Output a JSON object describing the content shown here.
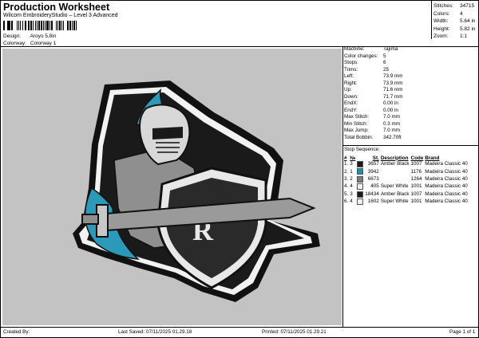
{
  "header": {
    "title": "Production Worksheet",
    "subtitle": "Wilcom EmbroideryStudio – Level 3 Advanced",
    "design_label": "Design:",
    "design_value": "Aroyo 5,8in",
    "colorway_label": "Colorway:",
    "colorway_value": "Colorway 1"
  },
  "stats": [
    {
      "label": "Stitches:",
      "value": "34715"
    },
    {
      "label": "Colors:",
      "value": "4"
    },
    {
      "label": "Width:",
      "value": "5.64 in"
    },
    {
      "label": "Height:",
      "value": "5.82 in"
    },
    {
      "label": "Zoom:",
      "value": "1:1"
    }
  ],
  "info": [
    {
      "label": "Machine:",
      "value": "Tajima"
    },
    {
      "label": "Color changes:",
      "value": "5"
    },
    {
      "label": "Stops:",
      "value": "6"
    },
    {
      "label": "Trims:",
      "value": "25"
    },
    {
      "label": "Left:",
      "value": "73.9 mm"
    },
    {
      "label": "Right:",
      "value": "73.9 mm"
    },
    {
      "label": "Up:",
      "value": "71.6 mm"
    },
    {
      "label": "Down:",
      "value": "71.7 mm"
    },
    {
      "label": "EndX:",
      "value": "0.00 in"
    },
    {
      "label": "EndY:",
      "value": "0.00 in"
    },
    {
      "label": "Max Stitch:",
      "value": "7.0 mm"
    },
    {
      "label": "Min Stitch:",
      "value": "0.3 mm"
    },
    {
      "label": "Max Jump:",
      "value": "7.0 mm"
    },
    {
      "label": "Total Bobbin:",
      "value": "342.70ft"
    }
  ],
  "stop_sequence": {
    "title": "Stop Sequence:",
    "headers": [
      "#",
      "№",
      "St.",
      "Description",
      "Code",
      "Brand"
    ],
    "rows": [
      {
        "num": "1.",
        "n": "3",
        "color": "#1a1a1a",
        "st": "3657",
        "desc": "Amber Black",
        "code": "1007",
        "brand": "Madeira Classic 40"
      },
      {
        "num": "2.",
        "n": "1",
        "color": "#1f8fb0",
        "st": "3942",
        "desc": "",
        "code": "1176",
        "brand": "Madeira Classic 40"
      },
      {
        "num": "3.",
        "n": "2",
        "color": "#7c7c7c",
        "st": "6673",
        "desc": "",
        "code": "1264",
        "brand": "Madeira Classic 40"
      },
      {
        "num": "4.",
        "n": "4",
        "color": "#eeeeee",
        "st": "405",
        "desc": "Super White",
        "code": "1001",
        "brand": "Madeira Classic 40"
      },
      {
        "num": "5.",
        "n": "3",
        "color": "#1a1a1a",
        "st": "18434",
        "desc": "Amber Black",
        "code": "1007",
        "brand": "Madeira Classic 40"
      },
      {
        "num": "6.",
        "n": "4",
        "color": "#eeeeee",
        "st": "1602",
        "desc": "Super White",
        "code": "1001",
        "brand": "Madeira Classic 40"
      }
    ]
  },
  "footer": {
    "created": "Created By:",
    "last_saved": "Last Saved: 07/11/2025 01.29.18",
    "printed": "Printed: 07/11/2025 01.29.21",
    "page": "Page 1 of 1"
  }
}
